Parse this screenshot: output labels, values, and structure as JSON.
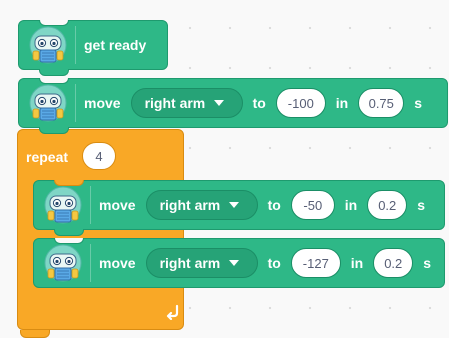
{
  "blocks": {
    "get_ready": {
      "label": "get ready",
      "icon": "robot-avatar-icon"
    },
    "move_1": {
      "verb": "move",
      "part": "right arm",
      "to_word": "to",
      "position": "-100",
      "in_word": "in",
      "duration": "0.75",
      "unit": "s"
    },
    "repeat": {
      "label": "repeat",
      "count": "4",
      "arrow_icon": "loop-arrow-icon"
    },
    "move_2": {
      "verb": "move",
      "part": "right arm",
      "to_word": "to",
      "position": "-50",
      "in_word": "in",
      "duration": "0.2",
      "unit": "s"
    },
    "move_3": {
      "verb": "move",
      "part": "right arm",
      "to_word": "to",
      "position": "-127",
      "in_word": "in",
      "duration": "0.2",
      "unit": "s"
    }
  },
  "colors": {
    "motion_block": "#2eb887",
    "control_block": "#f9a826",
    "workspace_background": "#f9f9f9"
  }
}
